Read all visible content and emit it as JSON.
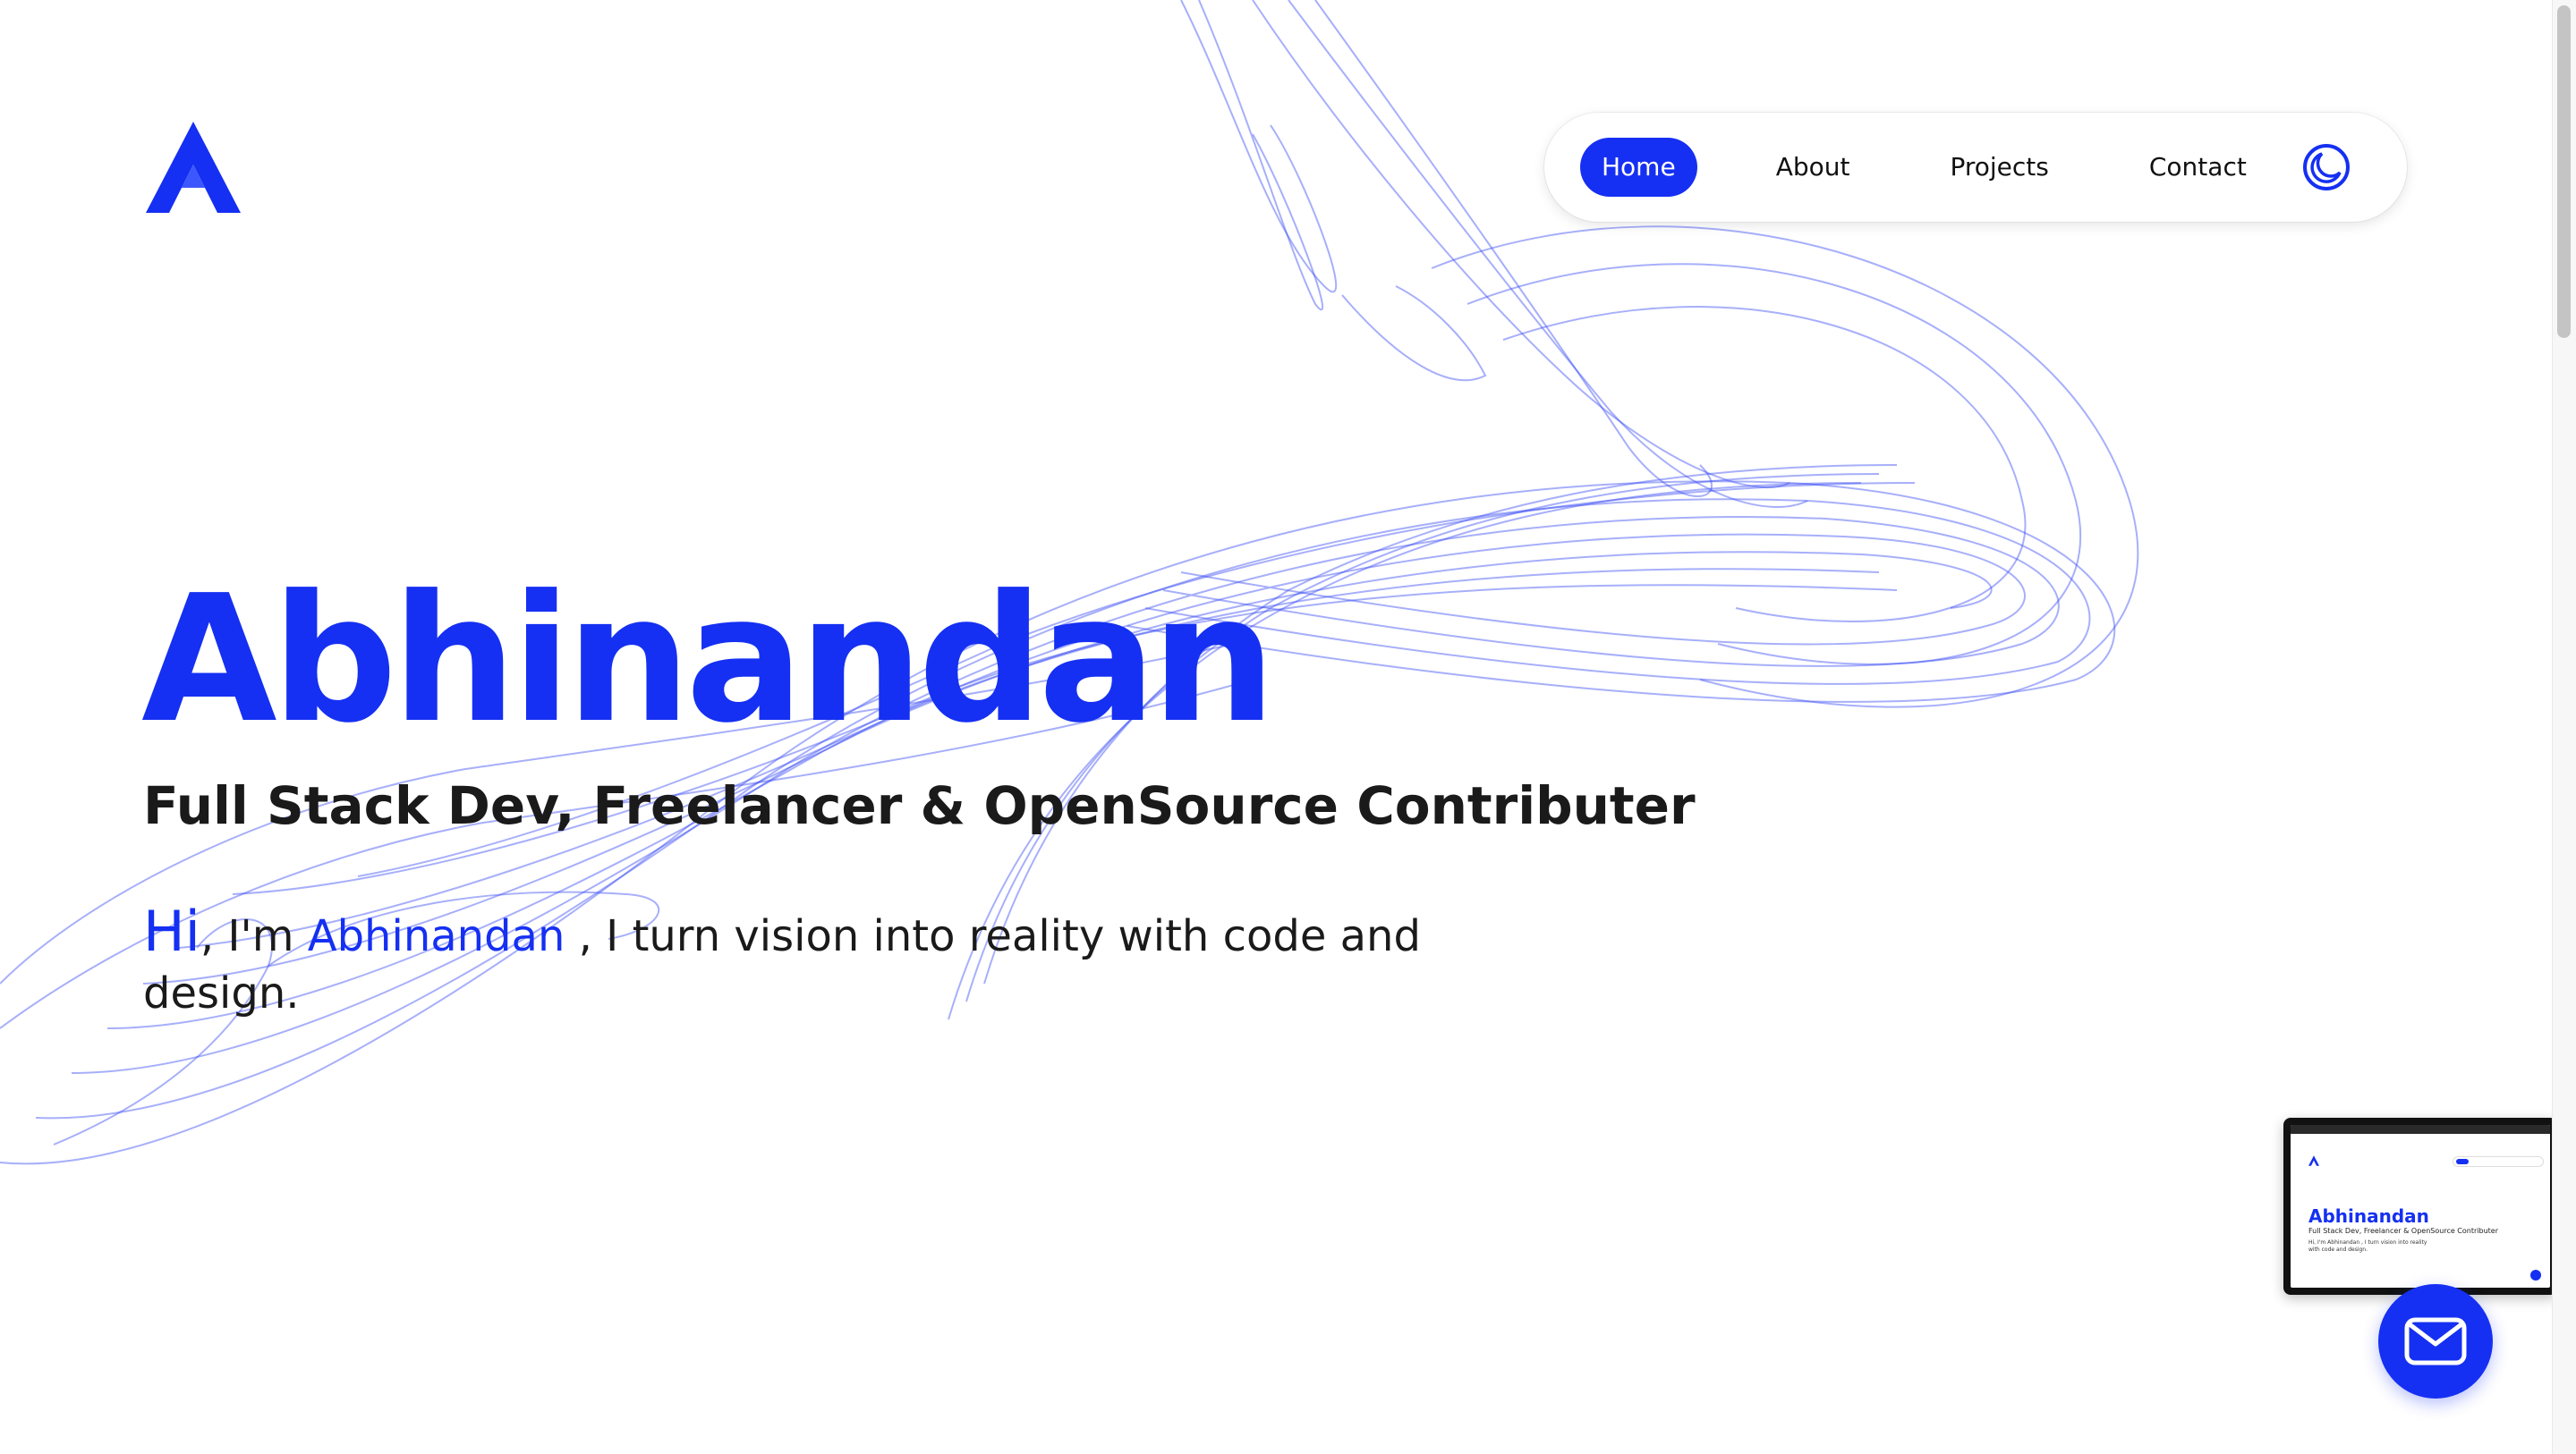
{
  "brand": {
    "logo_icon": "a-letter-logo-icon",
    "accent_color": "#1530f2"
  },
  "nav": {
    "items": [
      {
        "label": "Home",
        "active": true
      },
      {
        "label": "About",
        "active": false
      },
      {
        "label": "Projects",
        "active": false
      },
      {
        "label": "Contact",
        "active": false
      }
    ],
    "theme_toggle_icon": "moon-icon"
  },
  "hero": {
    "name": "Abhinandan",
    "subtitle": "Full Stack Dev, Freelancer & OpenSource Contributer",
    "intro": {
      "greeting": "Hi",
      "part1": ", I'm ",
      "name": "Abhinandan",
      "part2": " , I turn vision into reality with code and design."
    }
  },
  "preview": {
    "name": "Abhinandan",
    "subtitle": "Full Stack Dev, Freelancer & OpenSource Contributer",
    "intro": "Hi, I'm Abhinandan , I turn vision into reality with code and design."
  },
  "contact_fab": {
    "icon": "mail-icon"
  },
  "colors": {
    "background": "#ffffff",
    "text": "#1a1a1a",
    "accent": "#1530f2",
    "swirl": "#3b4ef5"
  }
}
